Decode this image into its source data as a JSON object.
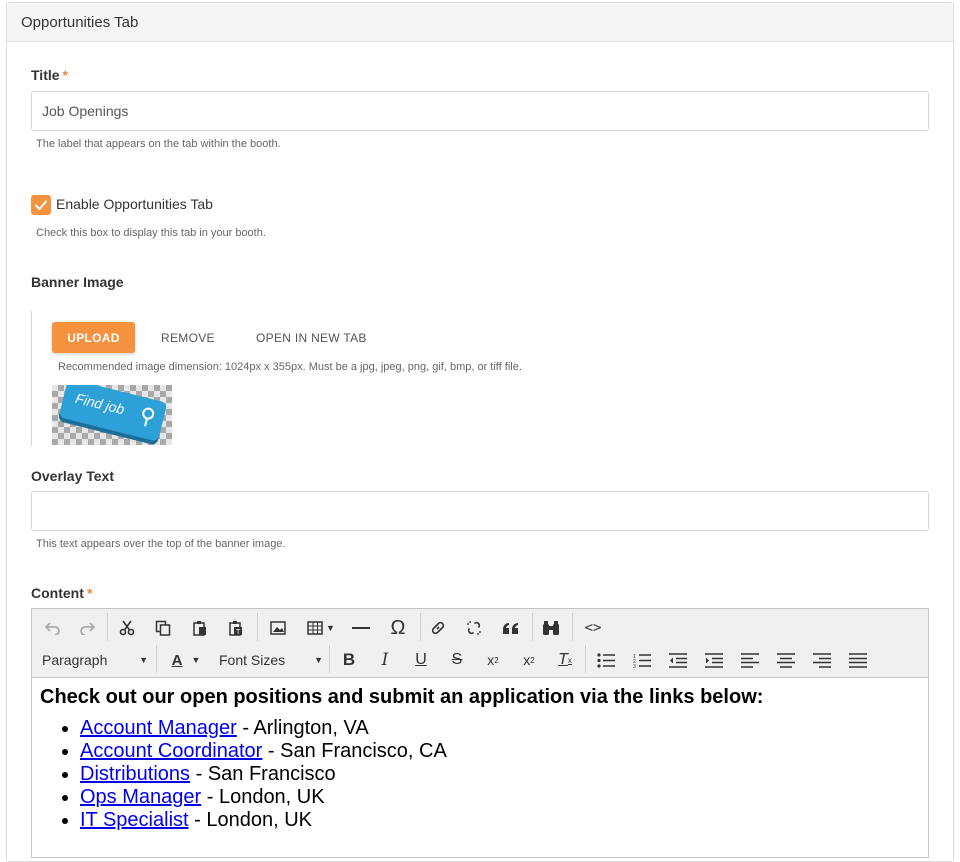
{
  "panel": {
    "title": "Opportunities Tab"
  },
  "title_field": {
    "label": "Title",
    "required_mark": "*",
    "value": "Job Openings",
    "help": "The label that appears on the tab within the booth."
  },
  "enable_tab": {
    "label": "Enable Opportunities Tab",
    "checked": true,
    "help": "Check this box to display this tab in your booth."
  },
  "banner": {
    "label": "Banner Image",
    "upload_label": "UPLOAD",
    "remove_label": "REMOVE",
    "open_label": "OPEN IN NEW TAB",
    "help": "Recommended image dimension: 1024px x 355px. Must be a jpg, jpeg, png, gif, bmp, or tiff file.",
    "thumb_text": "Find job"
  },
  "overlay": {
    "label": "Overlay Text",
    "value": "",
    "help": "This text appears over the top of the banner image."
  },
  "content_field": {
    "label": "Content",
    "required_mark": "*"
  },
  "toolbar": {
    "format_select": "Paragraph",
    "font_color": "A",
    "font_size_select": "Font Sizes",
    "bold": "B",
    "italic": "I",
    "underline": "U",
    "strike": "S"
  },
  "editor": {
    "heading": "Check out our open positions and submit an application via the links below:",
    "jobs": [
      {
        "title": "Account Manager",
        "location": " - Arlington, VA"
      },
      {
        "title": "Account Coordinator",
        "location": " - San Francisco, CA"
      },
      {
        "title": "Distributions",
        "location": " - San Francisco"
      },
      {
        "title": "Ops Manager",
        "location": " - London, UK"
      },
      {
        "title": "IT Specialist",
        "location": " - London, UK"
      }
    ]
  },
  "colors": {
    "accent": "#f4923f",
    "link": "#0000ee"
  }
}
